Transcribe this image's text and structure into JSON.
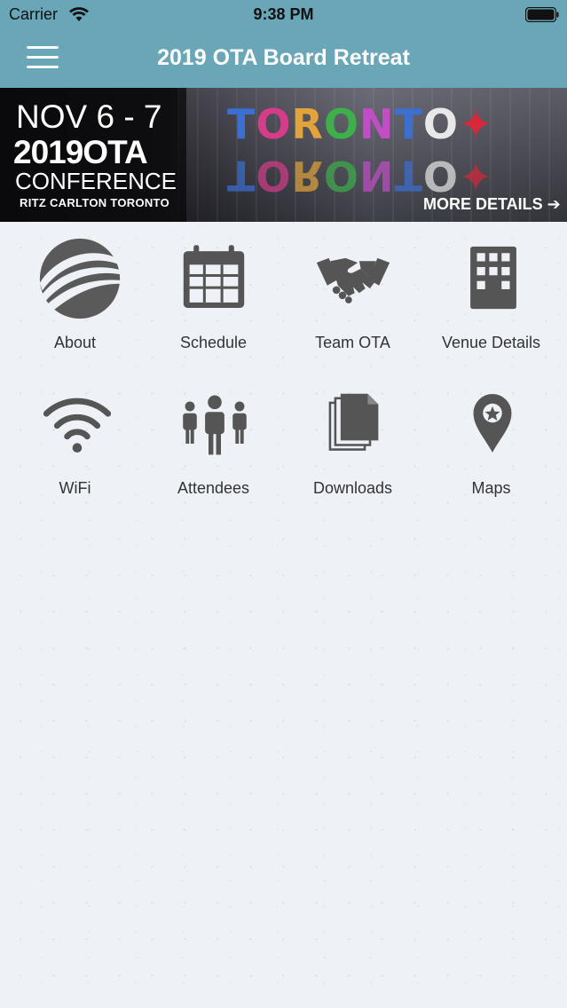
{
  "status": {
    "carrier": "Carrier",
    "time": "9:38 PM"
  },
  "nav": {
    "title": "2019 OTA Board Retreat",
    "menu_icon": "hamburger-menu-icon"
  },
  "banner": {
    "date": "NOV 6 - 7",
    "year": "2019OTA",
    "conference": "CONFERENCE",
    "venue": "RITZ CARLTON TORONTO",
    "sign": "TORONTO",
    "cta": "MORE DETAILS ➔"
  },
  "tiles": [
    {
      "label": "About",
      "icon": "about-logo-icon"
    },
    {
      "label": "Schedule",
      "icon": "calendar-icon"
    },
    {
      "label": "Team OTA",
      "icon": "handshake-icon"
    },
    {
      "label": "Venue Details",
      "icon": "building-icon"
    },
    {
      "label": "WiFi",
      "icon": "wifi-icon"
    },
    {
      "label": "Attendees",
      "icon": "people-icon"
    },
    {
      "label": "Downloads",
      "icon": "documents-icon"
    },
    {
      "label": "Maps",
      "icon": "map-pin-icon"
    }
  ],
  "colors": {
    "nav_bg": "#68a6b8",
    "icon_gray": "#555555",
    "page_bg": "#eef1f5"
  }
}
